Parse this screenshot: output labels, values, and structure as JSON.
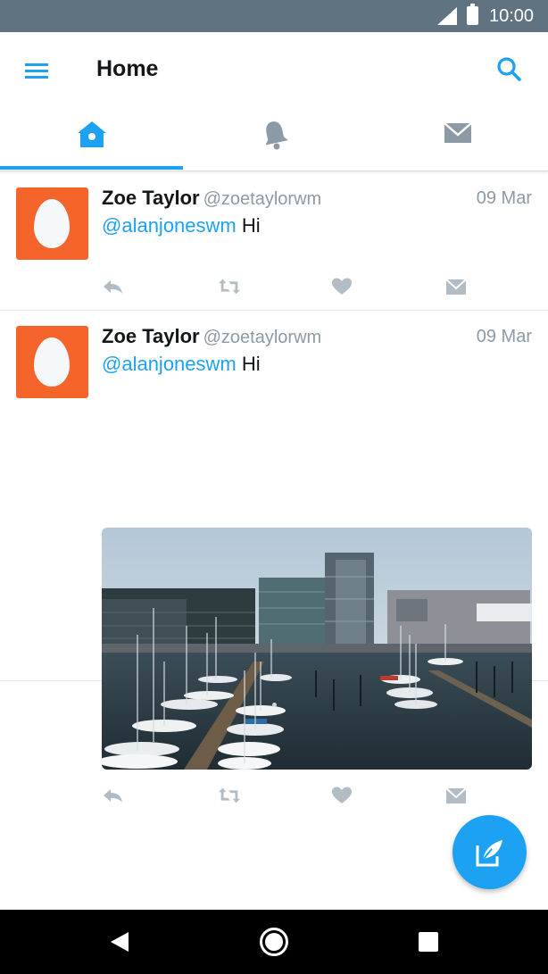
{
  "status_bar": {
    "time": "10:00"
  },
  "app_bar": {
    "title": "Home"
  },
  "tabs": [
    {
      "name": "home",
      "icon": "home-icon",
      "active": true
    },
    {
      "name": "notifications",
      "icon": "bell-icon",
      "active": false
    },
    {
      "name": "messages",
      "icon": "envelope-icon",
      "active": false
    }
  ],
  "tweets": [
    {
      "name": "Zoe Taylor",
      "handle": "@zoetaylorwm",
      "date": "09 Mar",
      "mention": "@alanjoneswm",
      "text": "Hi",
      "has_media": false
    },
    {
      "name": "Zoe Taylor",
      "handle": "@zoetaylorwm",
      "date": "09 Mar",
      "mention": "@alanjoneswm",
      "text": "Hi",
      "has_media": true,
      "media_icon": "harbor-photo"
    }
  ],
  "actions": [
    "reply-icon",
    "retweet-icon",
    "like-icon",
    "direct-message-icon"
  ],
  "fab": {
    "icon": "compose-tweet-icon"
  },
  "nav_bar": [
    "back-icon",
    "home-circle-icon",
    "recents-icon"
  ],
  "colors": {
    "accent": "#1da1f2",
    "status_bar": "#5f7380",
    "avatar": "#f5642a",
    "muted": "#8c9aa5"
  }
}
